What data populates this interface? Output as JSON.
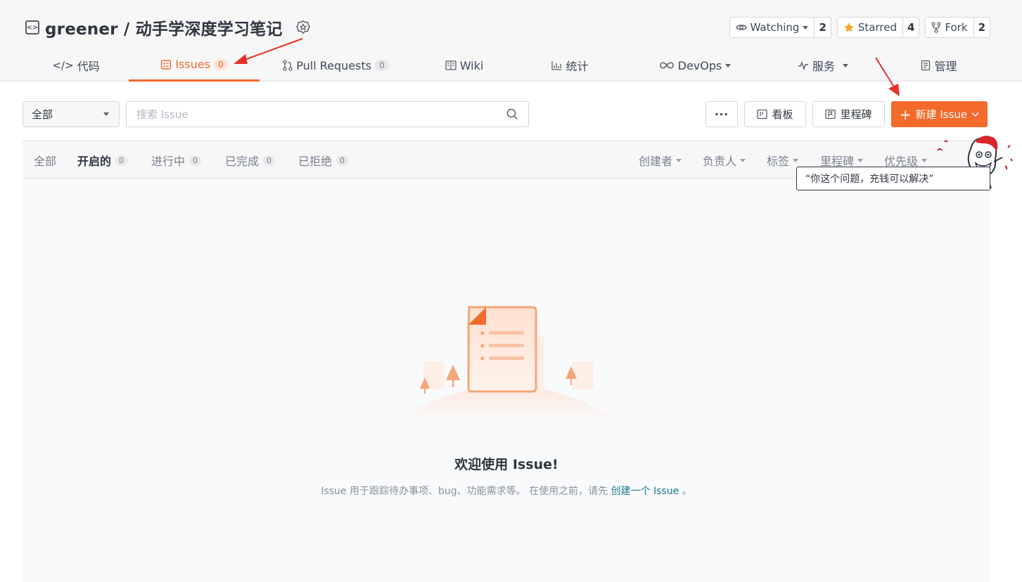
{
  "repo": {
    "title": "greener / 动手学深度学习笔记"
  },
  "actions": [
    {
      "label": "Watching",
      "count": "2",
      "icon": "eye-icon"
    },
    {
      "label": "Starred",
      "count": "4",
      "icon": "star-icon"
    },
    {
      "label": "Fork",
      "count": "2",
      "icon": "fork-icon"
    }
  ],
  "tabs": [
    {
      "label": "代码",
      "icon": "code-icon"
    },
    {
      "label": "Issues",
      "count": "0",
      "icon": "issues-icon",
      "active": true
    },
    {
      "label": "Pull Requests",
      "count": "0",
      "icon": "pull-request-icon"
    },
    {
      "label": "Wiki",
      "icon": "book-icon"
    },
    {
      "label": "统计",
      "icon": "bar-chart-icon"
    },
    {
      "label": "DevOps",
      "icon": "infinity-icon"
    },
    {
      "label": "服务",
      "icon": "pulse-icon"
    },
    {
      "label": "管理",
      "icon": "document-icon"
    }
  ],
  "toolbar": {
    "scope_select": "全部",
    "search_placeholder": "搜索 Issue",
    "more_label": "···",
    "board_label": "看板",
    "milestone_label": "里程碑",
    "new_issue_label": "新建 Issue"
  },
  "filters": {
    "states": [
      {
        "label": "全部"
      },
      {
        "label": "开启的",
        "count": "0"
      },
      {
        "label": "进行中",
        "count": "0"
      },
      {
        "label": "已完成",
        "count": "0"
      },
      {
        "label": "已拒绝",
        "count": "0"
      }
    ],
    "dropdowns": [
      "创建者",
      "负责人",
      "标签",
      "里程碑",
      "优先级"
    ]
  },
  "empty_state": {
    "title": "欢迎使用 Issue!",
    "desc_prefix": "Issue 用于跟踪待办事项、bug、功能需求等。 在使用之前，请先 ",
    "desc_link": "创建一个 Issue",
    "desc_suffix": " 。"
  },
  "tooltip": {
    "text": "“你这个问题，充钱可以解决”"
  },
  "colors": {
    "accent": "#f36a2a",
    "link": "#1a7c8f",
    "annotation_arrow": "#e8312a"
  }
}
